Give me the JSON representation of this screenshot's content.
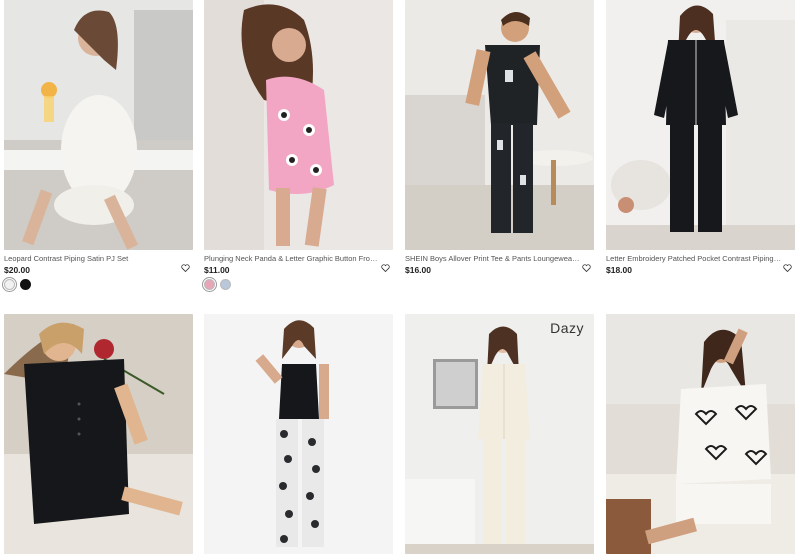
{
  "products": [
    {
      "title": "Leopard Contrast Piping Satin PJ Set",
      "price": "$20.00",
      "swatches": [
        "#f2f2f2",
        "#111111"
      ],
      "image_alt": "woman in white satin pajama set with contrast piping"
    },
    {
      "title": "Plunging Neck Panda & Letter Graphic Button Front Sleep Ro...",
      "price": "$11.00",
      "swatches": [
        "#e8a5b8",
        "#b9c7da"
      ],
      "image_alt": "woman in pink panda print sleep romper"
    },
    {
      "title": "SHEIN Boys Allover Print Tee & Pants Loungewear Set",
      "price": "$16.00",
      "swatches": [],
      "image_alt": "boy in black allover print loungewear set"
    },
    {
      "title": "Letter Embroidery Patched Pocket Contrast Piping PJ Set",
      "price": "$18.00",
      "swatches": [],
      "image_alt": "woman in black long sleeve pajama set"
    },
    {
      "image_alt": "woman in black short romper"
    },
    {
      "image_alt": "woman in black tank top and printed pants"
    },
    {
      "brand": "Dazy",
      "image_alt": "woman in cream long sleeve lounge set"
    },
    {
      "image_alt": "woman in white heart print short pajama set"
    }
  ],
  "icons": {
    "wishlist": "heart-outline-icon"
  }
}
